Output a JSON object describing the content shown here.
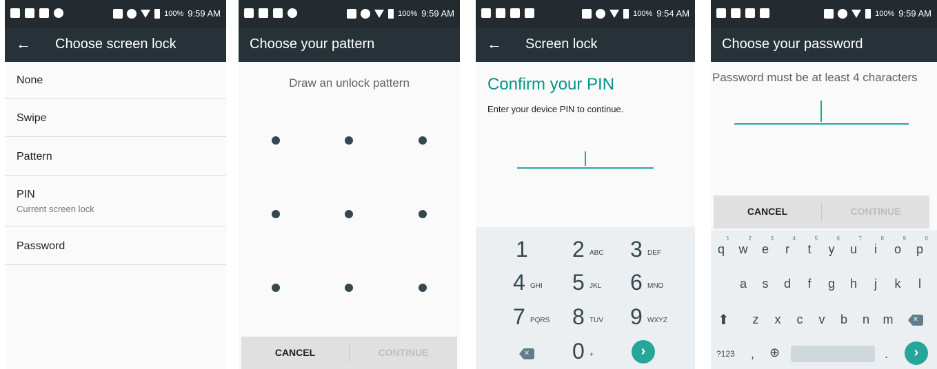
{
  "panels": [
    {
      "time": "9:59 AM",
      "battery": "100%",
      "title": "Choose screen lock",
      "items": [
        {
          "label": "None"
        },
        {
          "label": "Swipe"
        },
        {
          "label": "Pattern"
        },
        {
          "label": "PIN",
          "sublabel": "Current screen lock"
        },
        {
          "label": "Password"
        }
      ]
    },
    {
      "time": "9:59 AM",
      "battery": "100%",
      "title": "Choose your pattern",
      "hint": "Draw an unlock pattern",
      "cancel": "CANCEL",
      "continue": "CONTINUE"
    },
    {
      "time": "9:54 AM",
      "battery": "100%",
      "title": "Screen lock",
      "heading": "Confirm your PIN",
      "subtitle": "Enter your device PIN to continue.",
      "keys": [
        {
          "digit": "1",
          "letters": ""
        },
        {
          "digit": "2",
          "letters": "ABC"
        },
        {
          "digit": "3",
          "letters": "DEF"
        },
        {
          "digit": "4",
          "letters": "GHI"
        },
        {
          "digit": "5",
          "letters": "JKL"
        },
        {
          "digit": "6",
          "letters": "MNO"
        },
        {
          "digit": "7",
          "letters": "PQRS"
        },
        {
          "digit": "8",
          "letters": "TUV"
        },
        {
          "digit": "9",
          "letters": "WXYZ"
        },
        {
          "digit": "0",
          "letters": "+"
        }
      ]
    },
    {
      "time": "9:59 AM",
      "battery": "100%",
      "title": "Choose your password",
      "hint": "Password must be at least 4 characters",
      "cancel": "CANCEL",
      "continue": "CONTINUE",
      "row1": [
        "q",
        "w",
        "e",
        "r",
        "t",
        "y",
        "u",
        "i",
        "o",
        "p"
      ],
      "row1_numbers": [
        "1",
        "2",
        "3",
        "4",
        "5",
        "6",
        "7",
        "8",
        "9",
        "0"
      ],
      "row2": [
        "a",
        "s",
        "d",
        "f",
        "g",
        "h",
        "j",
        "k",
        "l"
      ],
      "row3": [
        "z",
        "x",
        "c",
        "v",
        "b",
        "n",
        "m"
      ],
      "symbols_key": "?123",
      "comma_key": ",",
      "period_key": "."
    }
  ],
  "colors": {
    "toolbar": "#263238",
    "statusbar": "#232b30",
    "accent": "#26a69a",
    "accent_text": "#009688",
    "disabled": "#bdbdbd"
  },
  "icons": [
    "back-arrow-icon",
    "backspace-icon",
    "go-arrow-icon",
    "shift-icon",
    "globe-icon",
    "battery-icon",
    "wifi-icon"
  ]
}
